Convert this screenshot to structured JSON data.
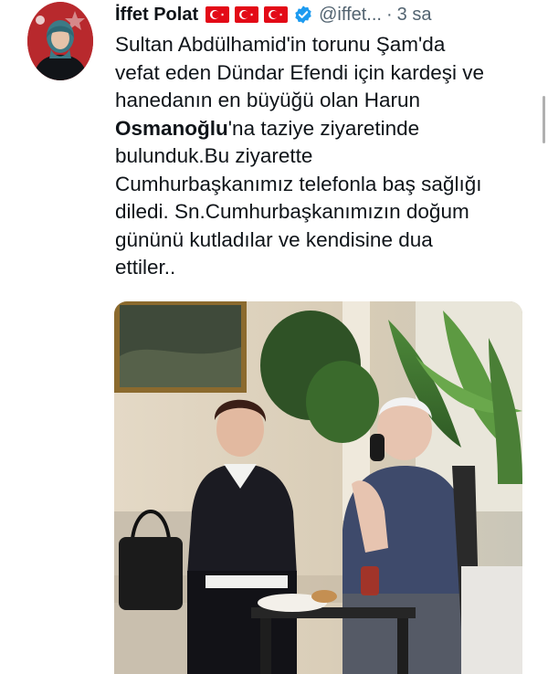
{
  "tweet": {
    "display_name": "İffet Polat",
    "handle": "@iffet...",
    "separator": "·",
    "time": "3 sa",
    "text_lines": [
      "Sultan Abdülhamid'in torunu Şam'da",
      "vefat eden Dündar Efendi için kardeşi ve",
      "hanedanın en büyüğü olan Harun",
      "Osmanoğlu|'na taziye ziyaretinde",
      "bulunduk.Bu ziyarette",
      "Cumhurbaşkanımız telefonla baş sağlığı",
      "diledi. Sn.Cumhurbaşkanımızın doğum",
      "gününü kutladılar ve kendisine dua",
      "ettiler.."
    ],
    "line4_bold": "Osmanoğlu",
    "line4_rest": "'na taziye ziyaretinde",
    "icons": {
      "flags": [
        "turkey-flag-icon",
        "turkey-flag-icon",
        "turkey-flag-icon"
      ],
      "verified": "verified-badge-icon"
    }
  },
  "colors": {
    "text": "#0f1419",
    "secondary": "#536471",
    "verified": "#1d9bf0",
    "flag_red": "#e30a17"
  }
}
